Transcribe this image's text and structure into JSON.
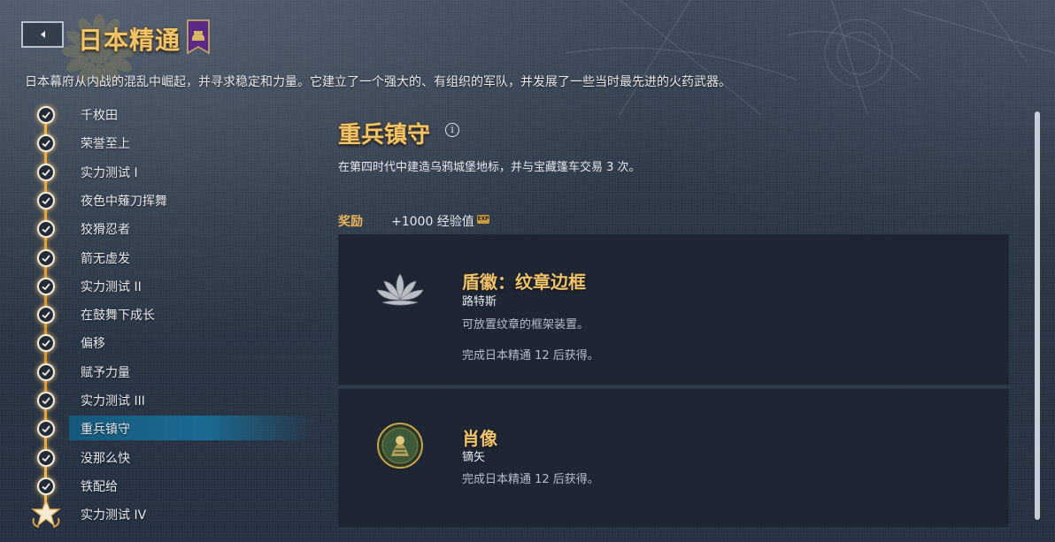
{
  "header": {
    "title": "日本精通",
    "subtitle": "日本幕府从内战的混乱中崛起，并寻求稳定和力量。它建立了一个强大的、有组织的军队，并发展了一些当时最先进的火药武器。"
  },
  "quests": [
    {
      "label": "千枚田",
      "status": "complete"
    },
    {
      "label": "荣誉至上",
      "status": "complete"
    },
    {
      "label": "实力测试 I",
      "status": "complete"
    },
    {
      "label": "夜色中薙刀挥舞",
      "status": "complete"
    },
    {
      "label": "狡猾忍者",
      "status": "complete"
    },
    {
      "label": "箭无虚发",
      "status": "complete"
    },
    {
      "label": "实力测试 II",
      "status": "complete"
    },
    {
      "label": "在鼓舞下成长",
      "status": "complete"
    },
    {
      "label": "偏移",
      "status": "complete"
    },
    {
      "label": "赋予力量",
      "status": "complete"
    },
    {
      "label": "实力测试 III",
      "status": "complete"
    },
    {
      "label": "重兵镇守",
      "status": "complete",
      "selected": true
    },
    {
      "label": "没那么快",
      "status": "complete"
    },
    {
      "label": "铁配给",
      "status": "complete"
    },
    {
      "label": "实力测试 IV",
      "status": "milestone"
    }
  ],
  "detail": {
    "title": "重兵镇守",
    "description": "在第四时代中建造乌鸦城堡地标，并与宝藏篷车交易 3 次。",
    "reward_label": "奖励",
    "reward_xp": "+1000 经验值",
    "xp_icon_text": "EXP",
    "rewards": [
      {
        "icon": "lotus-icon",
        "title": "盾徽：纹章边框",
        "subtitle": "路特斯",
        "description": "可放置纹章的框架装置。",
        "unlock": "完成日本精通 12 后获得。"
      },
      {
        "icon": "portrait-icon",
        "title": "肖像",
        "subtitle": "镝矢",
        "unlock": "完成日本精通 12 后获得。"
      }
    ]
  },
  "colors": {
    "gold_title": "#f2c46a",
    "selected_row": "#1b6b93",
    "card_bg": "#1e2533"
  }
}
